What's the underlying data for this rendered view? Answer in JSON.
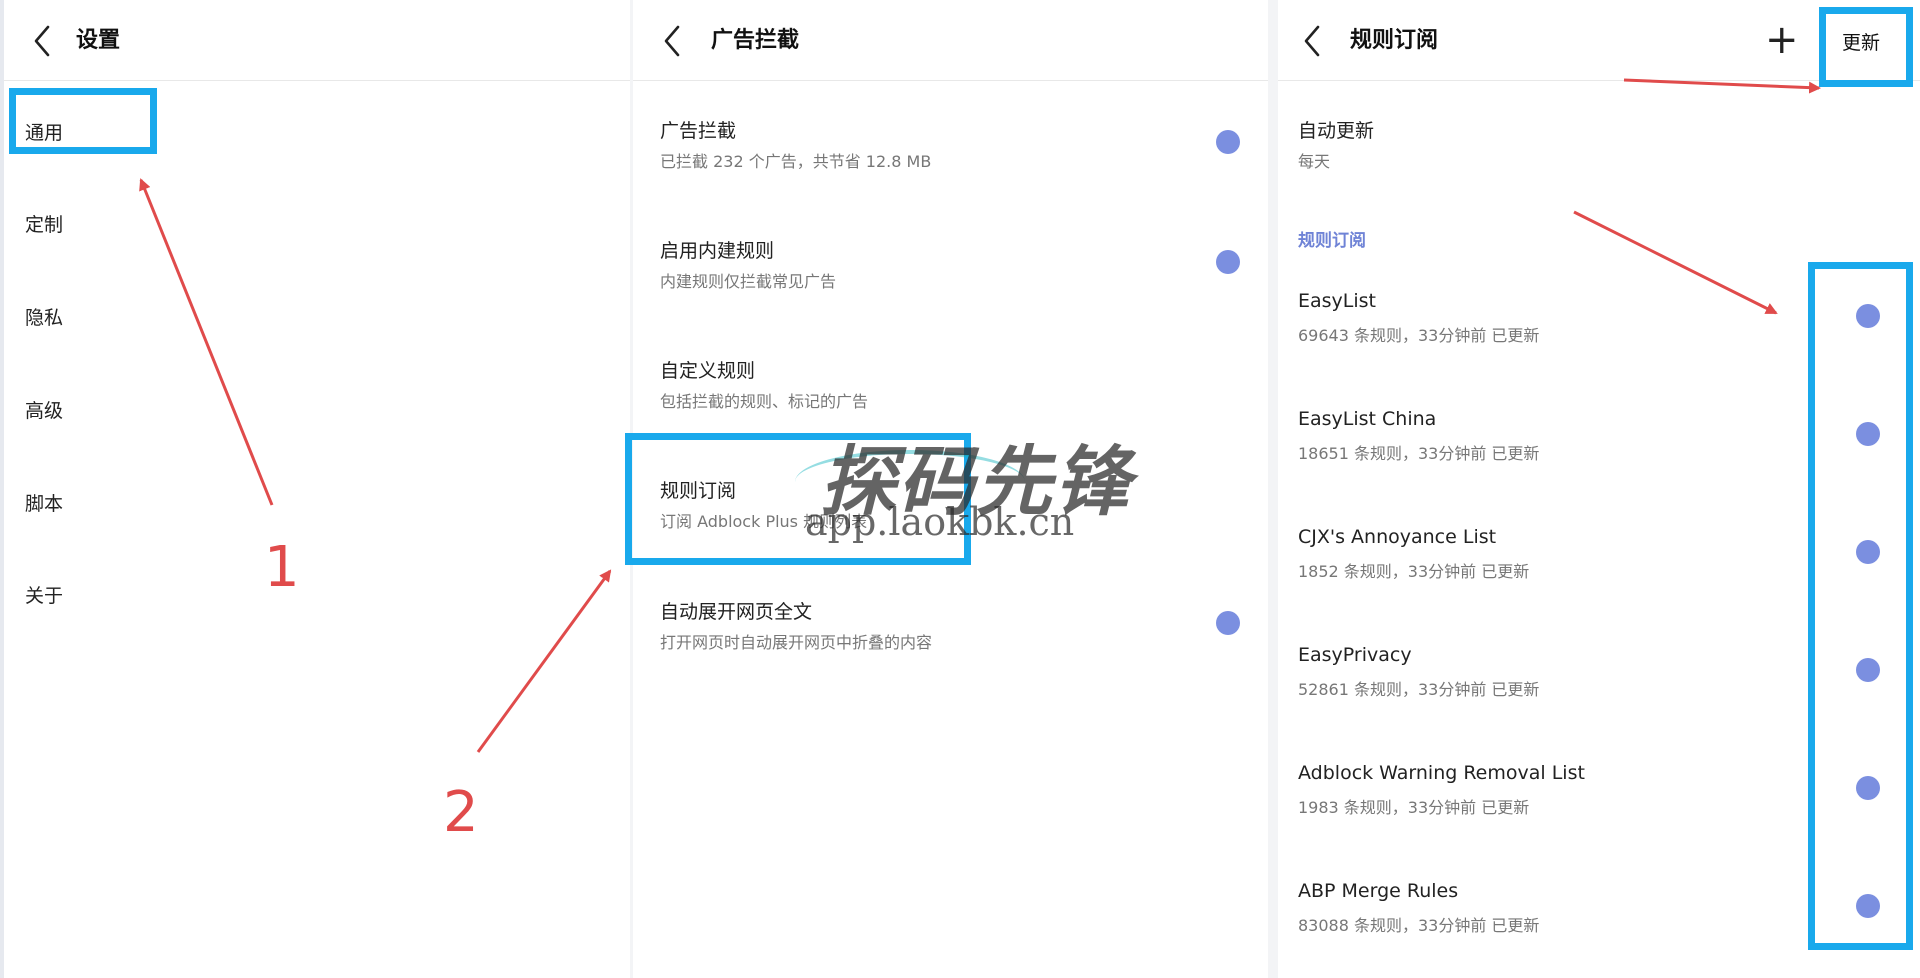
{
  "panel1": {
    "title": "设置",
    "items": [
      "通用",
      "定制",
      "隐私",
      "高级",
      "脚本",
      "关于"
    ]
  },
  "panel2": {
    "title": "广告拦截",
    "rows": [
      {
        "title": "广告拦截",
        "subtitle": "已拦截 232 个广告，共节省 12.8 MB"
      },
      {
        "title": "启用内建规则",
        "subtitle": "内建规则仅拦截常见广告"
      },
      {
        "title": "自定义规则",
        "subtitle": "包括拦截的规则、标记的广告"
      },
      {
        "title": "规则订阅",
        "subtitle": "订阅 Adblock Plus 规则列表"
      },
      {
        "title": "自动展开网页全文",
        "subtitle": "打开网页时自动展开网页中折叠的内容"
      }
    ]
  },
  "panel3": {
    "title": "规则订阅",
    "add_icon": "plus-icon",
    "update_label": "更新",
    "auto_update": {
      "title": "自动更新",
      "value": "每天"
    },
    "section_label": "规则订阅",
    "subscriptions": [
      {
        "name": "EasyList",
        "info": "69643 条规则，33分钟前 已更新"
      },
      {
        "name": "EasyList China",
        "info": "18651 条规则，33分钟前 已更新"
      },
      {
        "name": "CJX's Annoyance List",
        "info": "1852 条规则，33分钟前 已更新"
      },
      {
        "name": "EasyPrivacy",
        "info": "52861 条规则，33分钟前 已更新"
      },
      {
        "name": "Adblock Warning Removal List",
        "info": "1983 条规则，33分钟前 已更新"
      },
      {
        "name": "ABP Merge Rules",
        "info": "83088 条规则，33分钟前 已更新"
      }
    ]
  },
  "annotations": {
    "step1": "1",
    "step2": "2"
  },
  "watermark": {
    "brand": "探码先锋",
    "url": "app.laokbk.cn"
  },
  "colors": {
    "highlight": "#19a9ec",
    "arrow": "#e04b4b",
    "toggle": "#7b8fe0",
    "section": "#6f83d6"
  }
}
